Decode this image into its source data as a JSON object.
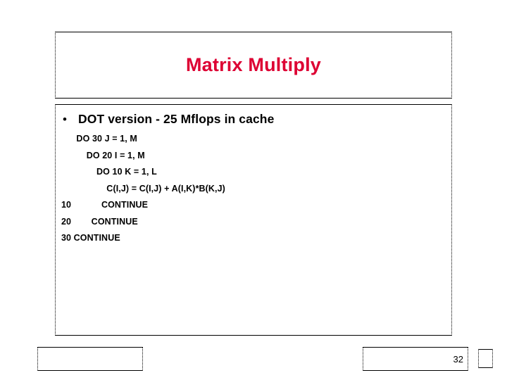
{
  "slide": {
    "title": "Matrix Multiply",
    "title_color": "#dd0033",
    "page_number": "32"
  },
  "body": {
    "bullet_marker": "•",
    "bullet_text": "DOT version - 25 Mflops in cache",
    "code_lines": [
      "      DO 30 J = 1, M",
      "          DO 20 I = 1, M",
      "              DO 10 K = 1, L",
      "                  C(I,J) = C(I,J) + A(I,K)*B(K,J)",
      "10            CONTINUE",
      "20        CONTINUE",
      "30 CONTINUE"
    ]
  },
  "footer": {
    "left_text": "",
    "corner_text": ""
  }
}
